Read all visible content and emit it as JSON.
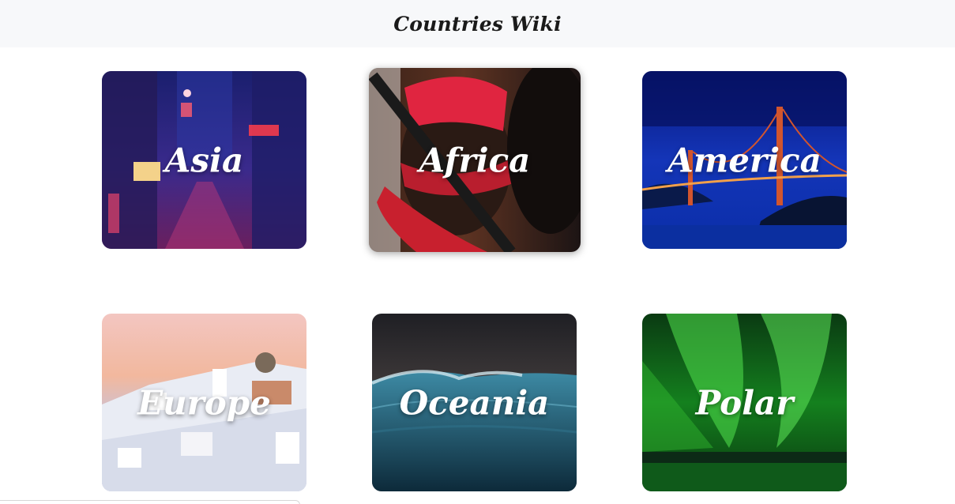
{
  "header": {
    "title": "Countries Wiki"
  },
  "regions": [
    {
      "label": "Asia"
    },
    {
      "label": "Africa"
    },
    {
      "label": "America"
    },
    {
      "label": "Europe"
    },
    {
      "label": "Oceania"
    },
    {
      "label": "Polar"
    }
  ],
  "colors": {
    "header_bg": "#f7f8fa",
    "title_text": "#1a1a1a",
    "label_text": "#ffffff"
  }
}
